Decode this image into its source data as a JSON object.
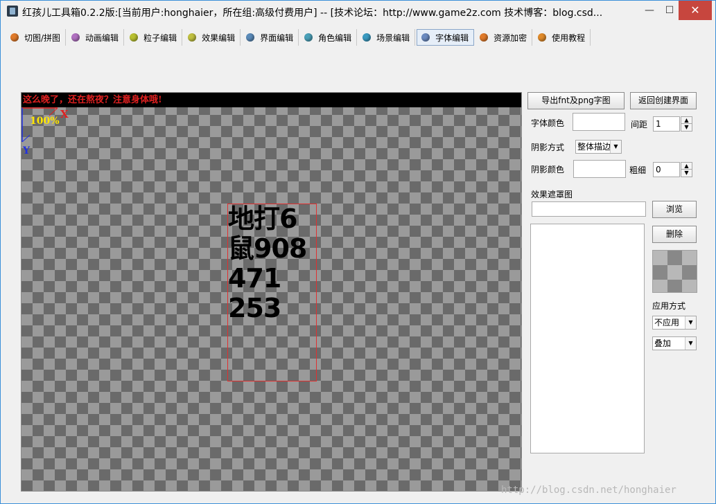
{
  "window": {
    "title": "红孩儿工具箱0.2.2版:[当前用户:honghaier，所在组:高级付费用户]  --  [技术论坛：http://www.game2z.com 技术博客：blog.csd...",
    "minimize": "—",
    "maximize": "☐",
    "close": "✕"
  },
  "toolbar": {
    "tabs": [
      {
        "label": "切图/拼图",
        "icon": "orange-ball-icon",
        "color": "#e07a2a"
      },
      {
        "label": "动画编辑",
        "icon": "purple-ball-icon",
        "color": "#b070c0"
      },
      {
        "label": "粒子编辑",
        "icon": "yellow-green-ball-icon",
        "color": "#b8c030"
      },
      {
        "label": "效果编辑",
        "icon": "yellow-green-ball-icon",
        "color": "#c0c040"
      },
      {
        "label": "界面编辑",
        "icon": "blue-ball-icon",
        "color": "#5a8ab8"
      },
      {
        "label": "角色编辑",
        "icon": "teal-ball-icon",
        "color": "#4aa0b8"
      },
      {
        "label": "场景编辑",
        "icon": "teal-ball-icon",
        "color": "#3a9ac0"
      },
      {
        "label": "字体编辑",
        "icon": "blue-ball-icon",
        "color": "#6a8ac0"
      },
      {
        "label": "资源加密",
        "icon": "orange-ball-icon",
        "color": "#e07a2a"
      },
      {
        "label": "使用教程",
        "icon": "orange-ball-icon",
        "color": "#e08a2a"
      }
    ],
    "active_index": 7
  },
  "canvas": {
    "banner": "这么晚了，还在熬夜？注意身体哦!",
    "zoom": "100%",
    "x_axis": "X",
    "y_axis": "Y",
    "glyph_lines": [
      "地打6",
      "鼠908",
      "471",
      "253"
    ]
  },
  "panel": {
    "export_button": "导出fnt及png字图",
    "back_button": "返回创建界面",
    "font_color_label": "字体颜色",
    "spacing_label": "间距",
    "spacing_value": "1",
    "shadow_mode_label": "阴影方式",
    "shadow_mode_value": "整体描边",
    "shadow_color_label": "阴影颜色",
    "thickness_label": "粗细",
    "thickness_value": "0",
    "mask_label": "效果遮罩图",
    "mask_path": "",
    "browse_button": "浏览",
    "delete_button": "删除",
    "apply_mode_label": "应用方式",
    "apply_value": "不应用",
    "blend_value": "叠加"
  },
  "watermark": "http://blog.csdn.net/honghaier"
}
